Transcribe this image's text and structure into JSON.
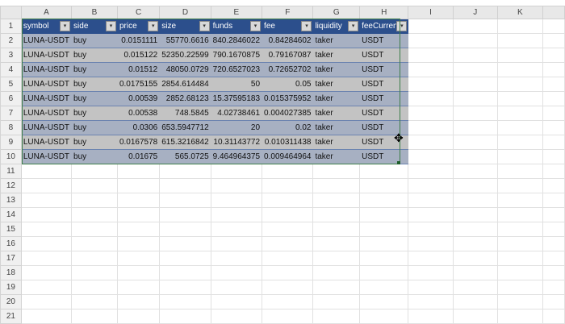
{
  "columns": [
    "A",
    "B",
    "C",
    "D",
    "E",
    "F",
    "G",
    "H",
    "I",
    "J",
    "K"
  ],
  "headers": [
    "symbol",
    "side",
    "price",
    "size",
    "funds",
    "fee",
    "liquidity",
    "feeCurrenc"
  ],
  "rows": [
    [
      "LUNA-USDT",
      "buy",
      "0.0151111",
      "55770.6616",
      "840.2846022",
      "0.84284602",
      "taker",
      "USDT"
    ],
    [
      "LUNA-USDT",
      "buy",
      "0.015122",
      "52350.22599",
      "790.1670875",
      "0.79167087",
      "taker",
      "USDT"
    ],
    [
      "LUNA-USDT",
      "buy",
      "0.01512",
      "48050.0729",
      "720.6527023",
      "0.72652702",
      "taker",
      "USDT"
    ],
    [
      "LUNA-USDT",
      "buy",
      "0.0175155",
      "2854.614484",
      "50",
      "0.05",
      "taker",
      "USDT"
    ],
    [
      "LUNA-USDT",
      "buy",
      "0.00539",
      "2852.68123",
      "15.37595183",
      "0.015375952",
      "taker",
      "USDT"
    ],
    [
      "LUNA-USDT",
      "buy",
      "0.00538",
      "748.5845",
      "4.02738461",
      "0.004027385",
      "taker",
      "USDT"
    ],
    [
      "LUNA-USDT",
      "buy",
      "0.0306",
      "653.5947712",
      "20",
      "0.02",
      "taker",
      "USDT"
    ],
    [
      "LUNA-USDT",
      "buy",
      "0.0167578",
      "615.3216842",
      "10.31143772",
      "0.010311438",
      "taker",
      "USDT"
    ],
    [
      "LUNA-USDT",
      "buy",
      "0.01675",
      "565.0725",
      "9.464964375",
      "0.009464964",
      "taker",
      "USDT"
    ]
  ],
  "row_count": 21,
  "colors": {
    "header": "#2c4f8c",
    "band_blue": "#a7b0c2",
    "band_gray": "#c3c3c3"
  }
}
